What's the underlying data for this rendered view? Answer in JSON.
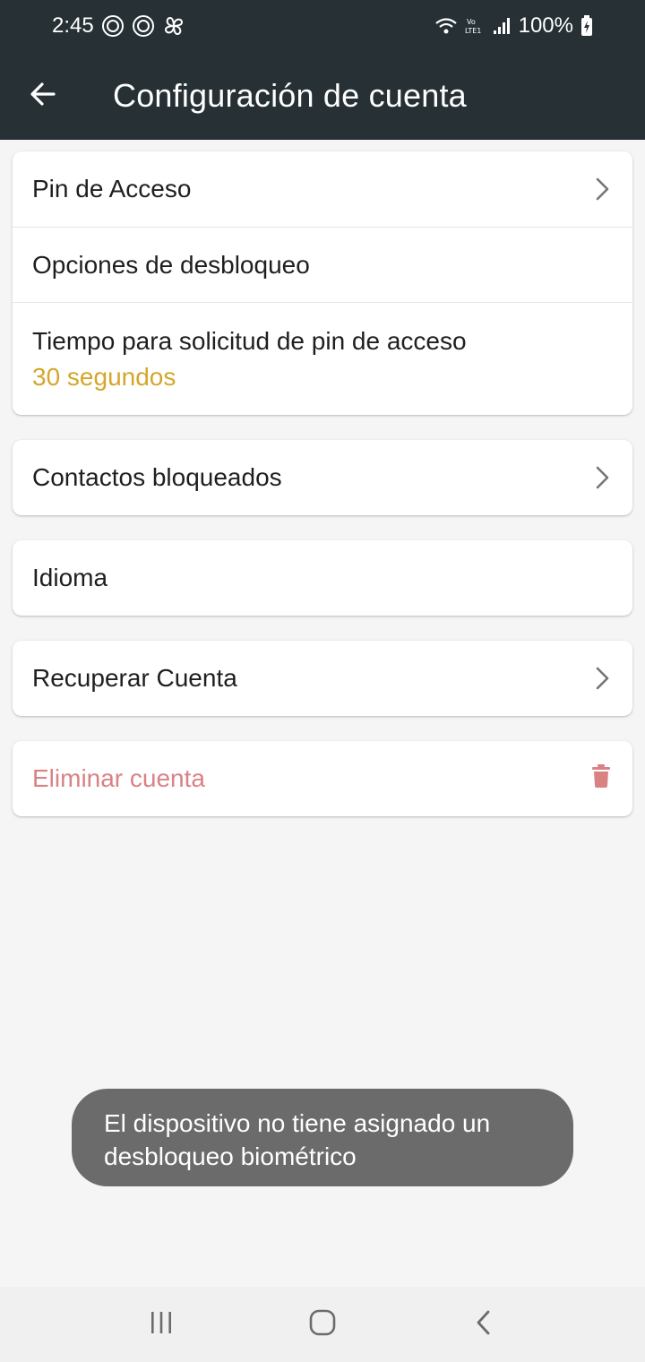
{
  "status_bar": {
    "time": "2:45",
    "battery": "100%",
    "icons": [
      "notification-icon",
      "notification-icon",
      "pinwheel-icon",
      "wifi-icon",
      "volte-icon",
      "signal-icon",
      "battery-charging-icon"
    ]
  },
  "app_bar": {
    "title": "Configuración de cuenta",
    "back_icon": "arrow-left-icon"
  },
  "security_card": {
    "items": [
      {
        "label": "Pin de Acceso",
        "icon": "chevron-right-icon"
      },
      {
        "label": "Opciones de desbloqueo"
      },
      {
        "label": "Tiempo para solicitud de pin de acceso",
        "value": "30 segundos"
      }
    ]
  },
  "blocked_contacts": {
    "label": "Contactos bloqueados",
    "icon": "chevron-right-icon"
  },
  "language": {
    "label": "Idioma"
  },
  "recover_account": {
    "label": "Recuperar Cuenta",
    "icon": "chevron-right-icon"
  },
  "delete_account": {
    "label": "Eliminar cuenta",
    "icon": "trash-icon"
  },
  "toast": {
    "message": "El dispositivo no tiene asignado un desbloqueo biométrico"
  },
  "nav_bar": {
    "icons": [
      "recent-apps-icon",
      "home-icon",
      "back-icon"
    ]
  },
  "colors": {
    "app_bar": "#263035",
    "accent_value": "#d4a62a",
    "danger": "#d98284",
    "toast_bg": "#6b6b6b",
    "background": "#f5f5f5"
  }
}
